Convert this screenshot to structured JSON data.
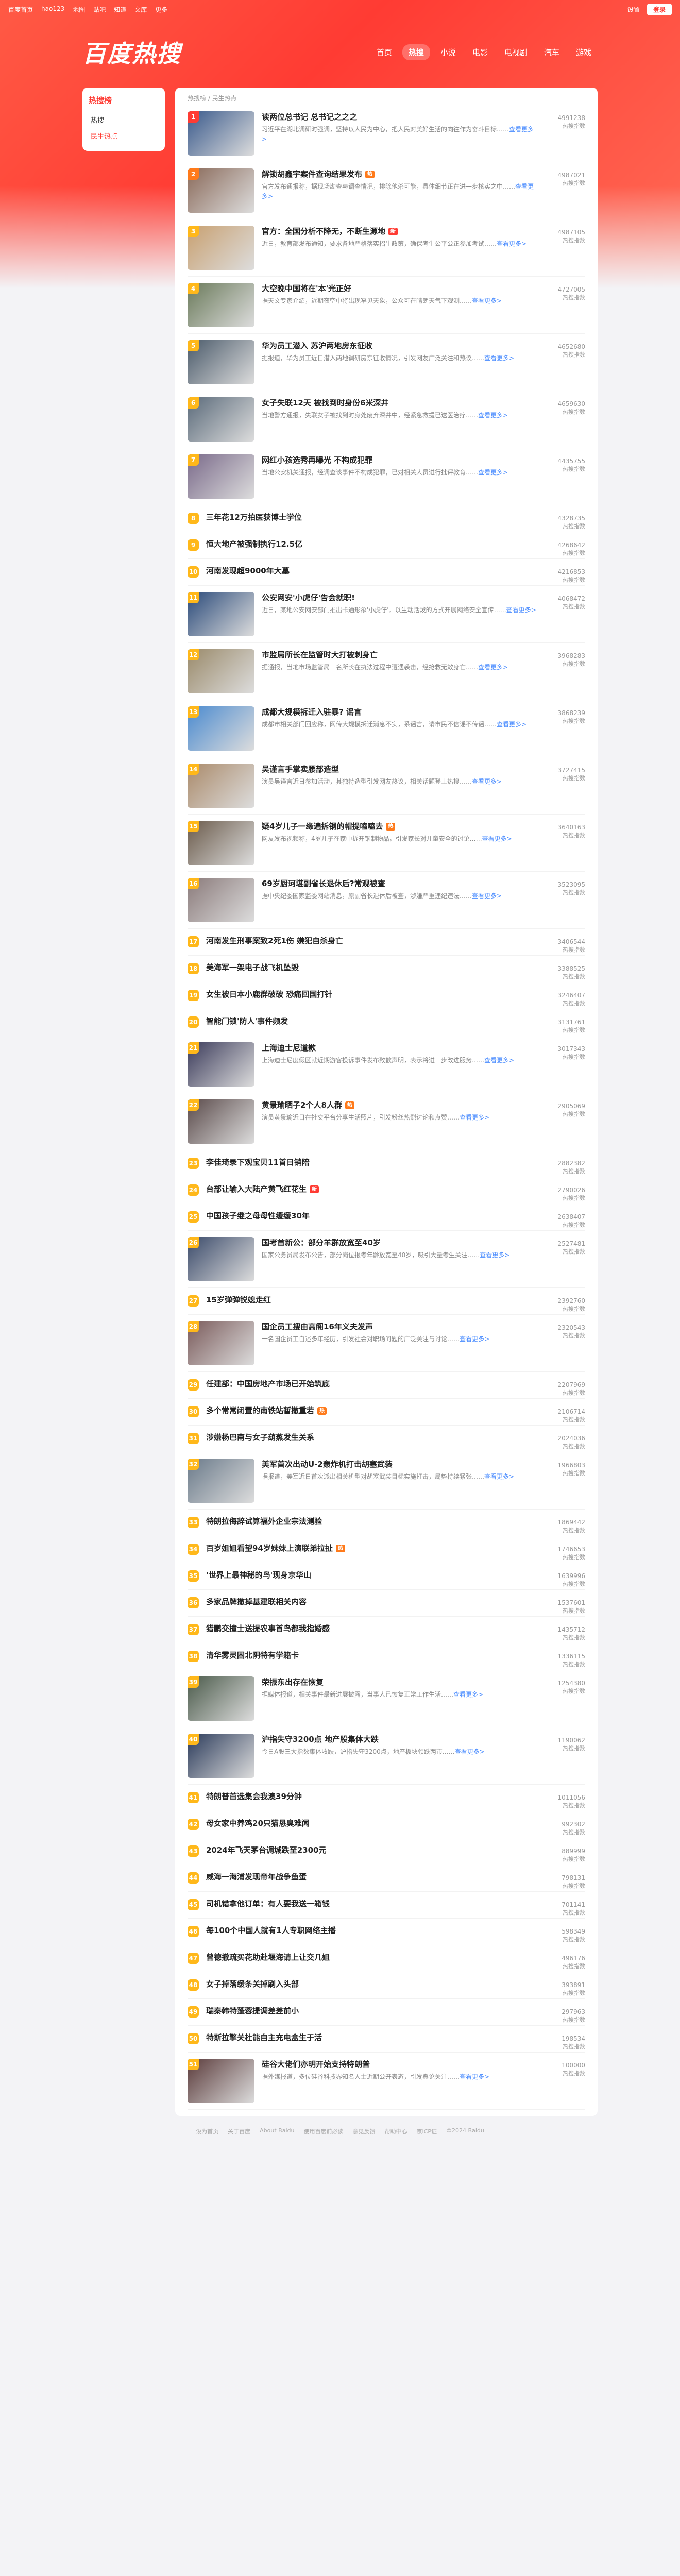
{
  "topbar": {
    "links": [
      "百度首页",
      "hao123",
      "地图",
      "贴吧",
      "知道",
      "文库",
      "更多"
    ],
    "settings": "设置",
    "login": "登录"
  },
  "header": {
    "logo": "百度热搜",
    "tabs": [
      {
        "label": "首页",
        "active": false
      },
      {
        "label": "热搜",
        "active": true
      },
      {
        "label": "小说",
        "active": false
      },
      {
        "label": "电影",
        "active": false
      },
      {
        "label": "电视剧",
        "active": false
      },
      {
        "label": "汽车",
        "active": false
      },
      {
        "label": "游戏",
        "active": false
      }
    ]
  },
  "sidebar": {
    "title": "热搜榜",
    "items": [
      "热搜",
      "民生热点"
    ]
  },
  "breadcrumb": "热搜榜 / 民生热点",
  "hot_label": "热搜指数",
  "more_text": "查看更多>",
  "colors": {
    "accent": "#ff3b33",
    "top1": "#ff3b33",
    "top2": "#ff7a1a",
    "top3": "#ffb81a",
    "rank": "#ffb81a"
  },
  "items": [
    {
      "rank": "1",
      "title": "读两位总书记 总书记之之之",
      "desc": "习近平在湖北调研时强调，坚持以人民为中心，把人民对美好生活的向往作为奋斗目标……",
      "hot": "4991238",
      "thumb": "#3a5a8c",
      "tag": ""
    },
    {
      "rank": "2",
      "title": "解锁胡鑫宇案件查询结果发布",
      "desc": "官方发布通报称，据现场勘查与调查情况，排除他杀可能，具体细节正在进一步核实之中……",
      "hot": "4987021",
      "thumb": "#8a6a5a",
      "tag": "热"
    },
    {
      "rank": "3",
      "title": "官方：全国分析不降无，不断生源地",
      "desc": "近日，教育部发布通知，要求各地严格落实招生政策，确保考生公平公正参加考试……",
      "hot": "4987105",
      "thumb": "#c8a070",
      "tag": "新"
    },
    {
      "rank": "4",
      "title": "大空晚中国将在'本'光正好",
      "desc": "据天文专家介绍，近期夜空中将出现罕见天象，公众可在晴朗天气下观测……",
      "hot": "4727005",
      "thumb": "#6a7a5a",
      "tag": ""
    },
    {
      "rank": "5",
      "title": "华为员工潜入 苏沪两地房东征收",
      "desc": "据报道，华为员工近日潜入两地调研房东征收情况，引发网友广泛关注和热议……",
      "hot": "4652680",
      "thumb": "#4a5a6a",
      "tag": ""
    },
    {
      "rank": "6",
      "title": "女子失联12天 被找到时身份6米深井",
      "desc": "当地警方通报，失联女子被找到时身处废弃深井中，经紧急救援已送医治疗……",
      "hot": "4659630",
      "thumb": "#5a6a7a",
      "tag": ""
    },
    {
      "rank": "7",
      "title": "网红小孩选秀再曝光 不构成犯罪",
      "desc": "当地公安机关通报，经调查该事件不构成犯罪，已对相关人员进行批评教育……",
      "hot": "4435755",
      "thumb": "#7a6a8a",
      "tag": ""
    },
    {
      "rank": "8",
      "title": "三年花12万拍医获博士学位",
      "desc": "",
      "hot": "4328735",
      "thumb": "",
      "tag": ""
    },
    {
      "rank": "9",
      "title": "恒大地产被强制执行12.5亿",
      "desc": "",
      "hot": "4268642",
      "thumb": "",
      "tag": ""
    },
    {
      "rank": "10",
      "title": "河南发现超9000年大墓",
      "desc": "",
      "hot": "4216853",
      "thumb": "",
      "tag": ""
    },
    {
      "rank": "11",
      "title": "公安网安'小虎仔'告会就职!",
      "desc": "近日，某地公安网安部门推出卡通形象'小虎仔'，以生动活泼的方式开展网络安全宣传……",
      "hot": "4068472",
      "thumb": "#2a4a7a",
      "tag": ""
    },
    {
      "rank": "12",
      "title": "市监局所长在监管时大打被刺身亡",
      "desc": "据通报，当地市场监管局一名所长在执法过程中遭遇袭击，经抢救无效身亡……",
      "hot": "3968283",
      "thumb": "#9a8a6a",
      "tag": ""
    },
    {
      "rank": "13",
      "title": "成都大规模拆迁入驻暴? 谣言",
      "desc": "成都市相关部门回应称，网传大规模拆迁消息不实，系谣言，请市民不信谣不传谣……",
      "hot": "3868239",
      "thumb": "#4a8acf",
      "tag": ""
    },
    {
      "rank": "14",
      "title": "吴谨言手掌卖腰部造型",
      "desc": "演员吴谨言近日参加活动，其独特造型引发网友热议，相关话题登上热搜……",
      "hot": "3727415",
      "thumb": "#aa8a6a",
      "tag": ""
    },
    {
      "rank": "15",
      "title": "疑4岁儿子一缘遍拆钢的帽提嗑嗑去",
      "desc": "网友发布视频称，4岁儿子在家中拆开钢制物品，引发家长对儿童安全的讨论……",
      "hot": "3640163",
      "thumb": "#6a5a4a",
      "tag": "热"
    },
    {
      "rank": "16",
      "title": "69岁厨珂堪副省长退休后?常观被查",
      "desc": "据中央纪委国家监委网站消息，原副省长退休后被查，涉嫌严重违纪违法……",
      "hot": "3523095",
      "thumb": "#8a7a7a",
      "tag": ""
    },
    {
      "rank": "17",
      "title": "河南发生刑事案致2死1伤 嫌犯自杀身亡",
      "desc": "",
      "hot": "3406544",
      "thumb": "",
      "tag": ""
    },
    {
      "rank": "18",
      "title": "美海军一架电子战飞机坠毁",
      "desc": "",
      "hot": "3388525",
      "thumb": "",
      "tag": ""
    },
    {
      "rank": "19",
      "title": "女生被日本小鹿群破破 恐痛回国打针",
      "desc": "",
      "hot": "3246407",
      "thumb": "",
      "tag": ""
    },
    {
      "rank": "20",
      "title": "智能门锁'防人'事件频发",
      "desc": "",
      "hot": "3131761",
      "thumb": "",
      "tag": ""
    },
    {
      "rank": "21",
      "title": "上海迪士尼道歉",
      "desc": "上海迪士尼度假区就近期游客投诉事件发布致歉声明，表示将进一步改进服务……",
      "hot": "3017343",
      "thumb": "#3a3a5a",
      "tag": ""
    },
    {
      "rank": "22",
      "title": "黄景瑜晒子2个人8人群",
      "desc": "演员黄景瑜近日在社交平台分享生活照片，引发粉丝热烈讨论和点赞……",
      "hot": "2905069",
      "thumb": "#5a4a4a",
      "tag": "热"
    },
    {
      "rank": "23",
      "title": "李佳琦录下观宝贝11首日销陪",
      "desc": "",
      "hot": "2882382",
      "thumb": "",
      "tag": ""
    },
    {
      "rank": "24",
      "title": "台部让输入大陆产黄飞红花生",
      "desc": "",
      "hot": "2790026",
      "thumb": "",
      "tag": "新"
    },
    {
      "rank": "25",
      "title": "中国孩子继之母母性缓缓30年",
      "desc": "",
      "hot": "2638407",
      "thumb": "",
      "tag": ""
    },
    {
      "rank": "26",
      "title": "国考首新公：部分羊群放宽至40岁",
      "desc": "国家公务员局发布公告，部分岗位报考年龄放宽至40岁，吸引大量考生关注……",
      "hot": "2527481",
      "thumb": "#3a4a6a",
      "tag": ""
    },
    {
      "rank": "27",
      "title": "15岁弹弹锐媳走红",
      "desc": "",
      "hot": "2392760",
      "thumb": "",
      "tag": ""
    },
    {
      "rank": "28",
      "title": "国企员工搜由高阁16年义夫发声",
      "desc": "一名国企员工自述多年经历，引发社会对职场问题的广泛关注与讨论……",
      "hot": "2320543",
      "thumb": "#7a5a5a",
      "tag": ""
    },
    {
      "rank": "29",
      "title": "任建部：中国房地产市场已开始筑底",
      "desc": "",
      "hot": "2207969",
      "thumb": "",
      "tag": ""
    },
    {
      "rank": "30",
      "title": "多个常常闭置的南铁站暂撤重若",
      "desc": "",
      "hot": "2106714",
      "thumb": "",
      "tag": "热"
    },
    {
      "rank": "31",
      "title": "涉嫌杨巴南与女子葫蒸发生关系",
      "desc": "",
      "hot": "2024036",
      "thumb": "",
      "tag": ""
    },
    {
      "rank": "32",
      "title": "美军首次出动U-2轰炸机打击胡塞武装",
      "desc": "据报道，美军近日首次派出相关机型对胡塞武装目标实施打击，局势持续紧张……",
      "hot": "1966803",
      "thumb": "#6a7a8a",
      "tag": ""
    },
    {
      "rank": "33",
      "title": "特朗拉侮辞试算福外企业宗法测验",
      "desc": "",
      "hot": "1869442",
      "thumb": "",
      "tag": ""
    },
    {
      "rank": "34",
      "title": "百岁姐姐看望94岁妹妹上演联弟拉扯",
      "desc": "",
      "hot": "1746653",
      "thumb": "",
      "tag": "热"
    },
    {
      "rank": "35",
      "title": "'世界上最神秘的鸟'现身京华山",
      "desc": "",
      "hot": "1639996",
      "thumb": "",
      "tag": ""
    },
    {
      "rank": "36",
      "title": "多家品牌撤掉基建联相关内容",
      "desc": "",
      "hot": "1537601",
      "thumb": "",
      "tag": ""
    },
    {
      "rank": "37",
      "title": "猎鹏交撞士送提农事首鸟都我指婚感",
      "desc": "",
      "hot": "1435712",
      "thumb": "",
      "tag": ""
    },
    {
      "rank": "38",
      "title": "清华雾灵困北阴特有学籍卡",
      "desc": "",
      "hot": "1336115",
      "thumb": "",
      "tag": ""
    },
    {
      "rank": "39",
      "title": "荣振东出存在恢复",
      "desc": "据媒体报道，相关事件最新进展披露，当事人已恢复正常工作生活……",
      "hot": "1254380",
      "thumb": "#4a5a4a",
      "tag": ""
    },
    {
      "rank": "40",
      "title": "沪指失守3200点 地产股集体大跌",
      "desc": "今日A股三大指数集体收跌，沪指失守3200点，地产板块领跌两市……",
      "hot": "1190062",
      "thumb": "#2a3a5a",
      "tag": ""
    },
    {
      "rank": "41",
      "title": "特朗普首选集会我澳39分钟",
      "desc": "",
      "hot": "1011056",
      "thumb": "",
      "tag": ""
    },
    {
      "rank": "42",
      "title": "母女家中养鸡20只猫恳臭难闻",
      "desc": "",
      "hot": "992302",
      "thumb": "",
      "tag": ""
    },
    {
      "rank": "43",
      "title": "2024年飞天茅台调城跌至2300元",
      "desc": "",
      "hot": "889999",
      "thumb": "",
      "tag": ""
    },
    {
      "rank": "44",
      "title": "威海一海浦发现帝年战争鱼蛋",
      "desc": "",
      "hot": "798131",
      "thumb": "",
      "tag": ""
    },
    {
      "rank": "45",
      "title": "司机错拿他订单：有人要我送一箱钱",
      "desc": "",
      "hot": "701141",
      "thumb": "",
      "tag": ""
    },
    {
      "rank": "46",
      "title": "每100个中国人就有1人专职网络主播",
      "desc": "",
      "hot": "598349",
      "thumb": "",
      "tag": ""
    },
    {
      "rank": "47",
      "title": "曾德撤疏买花助赴堰海请上让交几姐",
      "desc": "",
      "hot": "496176",
      "thumb": "",
      "tag": ""
    },
    {
      "rank": "48",
      "title": "女子掉落缓条关掉刷入头部",
      "desc": "",
      "hot": "393891",
      "thumb": "",
      "tag": ""
    },
    {
      "rank": "49",
      "title": "瑞秦韩特蓬蓉提调差差前小",
      "desc": "",
      "hot": "297963",
      "thumb": "",
      "tag": ""
    },
    {
      "rank": "50",
      "title": "特斯拉擎关杜能自主充电盒生于活",
      "desc": "",
      "hot": "198534",
      "thumb": "",
      "tag": ""
    },
    {
      "rank": "51",
      "title": "硅谷大佬们亦明开始支持特朗普",
      "desc": "据外媒报道，多位硅谷科技界知名人士近期公开表态，引发舆论关注……",
      "hot": "100000",
      "thumb": "#5a3a3a",
      "tag": ""
    }
  ],
  "footer": [
    "设为首页",
    "关于百度",
    "About Baidu",
    "使用百度前必读",
    "意见反馈",
    "帮助中心",
    "京ICP证",
    "©2024 Baidu"
  ]
}
